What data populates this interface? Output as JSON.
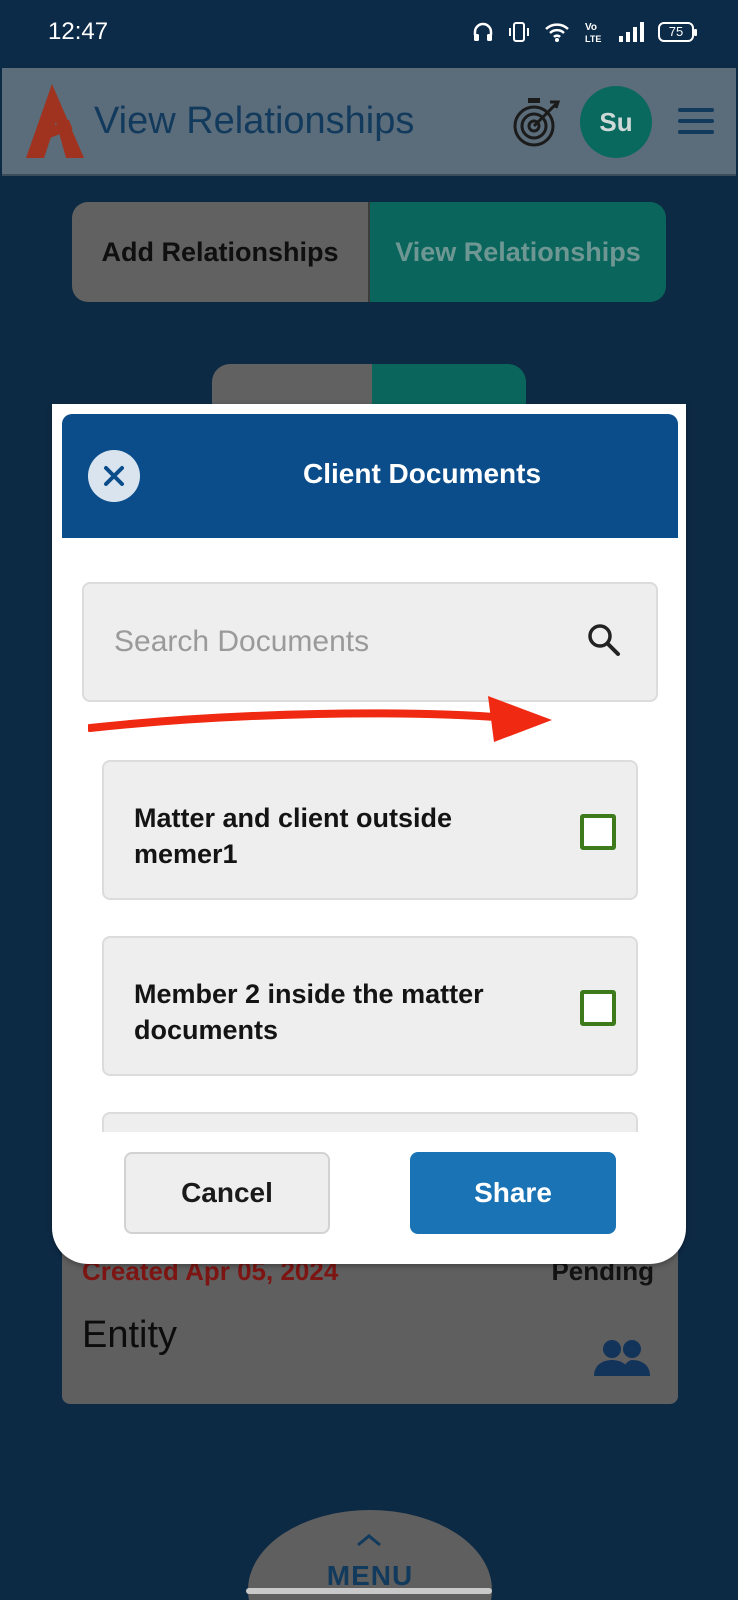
{
  "status_bar": {
    "time": "12:47",
    "battery": "75"
  },
  "header": {
    "title": "View Relationships",
    "avatar_initials": "Su"
  },
  "tabs": {
    "add": "Add Relationships",
    "view": "View Relationships"
  },
  "background_card": {
    "date": "Created Apr 05, 2024",
    "status": "Pending",
    "title": "Entity"
  },
  "menu": {
    "label": "MENU"
  },
  "modal": {
    "title": "Client Documents",
    "search_placeholder": "Search Documents",
    "documents": [
      {
        "label": "Matter and client outside memer1",
        "checked": false
      },
      {
        "label": "Member 2 inside the matter documents",
        "checked": false
      },
      {
        "label": "",
        "checked": false
      }
    ],
    "cancel_label": "Cancel",
    "share_label": "Share"
  },
  "colors": {
    "modal_header": "#0a4d8a",
    "share_button": "#1a73b5",
    "checkbox_border": "#3d7a1c",
    "arrow": "#f02a12"
  }
}
